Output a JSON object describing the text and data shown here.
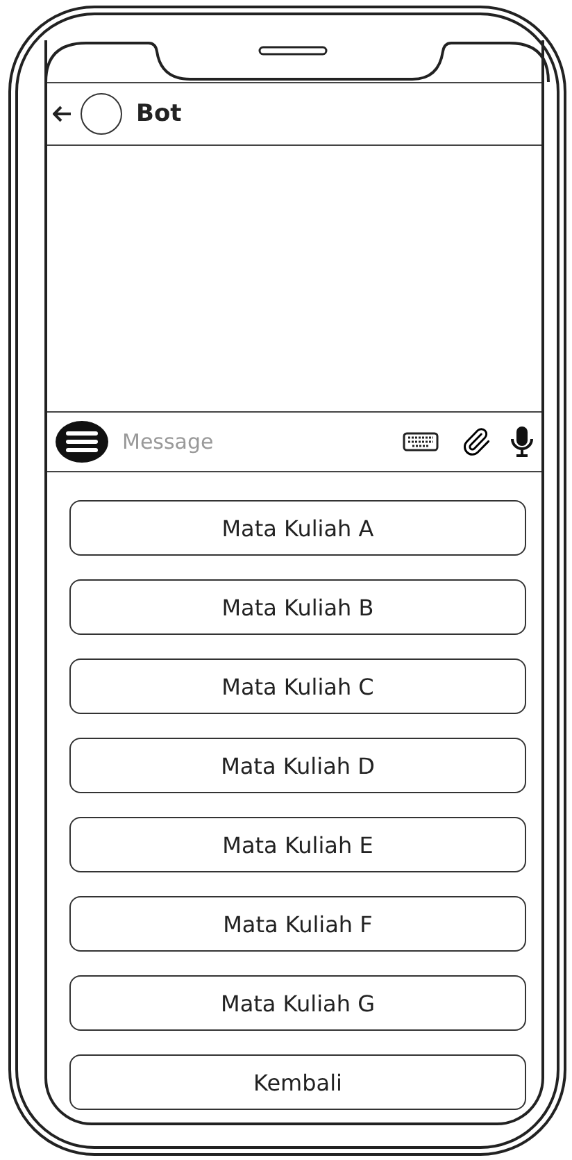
{
  "header": {
    "title": "Bot"
  },
  "composer": {
    "placeholder": "Message"
  },
  "options": [
    {
      "label": "Mata Kuliah A"
    },
    {
      "label": "Mata Kuliah B"
    },
    {
      "label": "Mata Kuliah C"
    },
    {
      "label": "Mata Kuliah D"
    },
    {
      "label": "Mata Kuliah E"
    },
    {
      "label": "Mata Kuliah F"
    },
    {
      "label": "Mata Kuliah G"
    },
    {
      "label": "Kembali"
    }
  ]
}
